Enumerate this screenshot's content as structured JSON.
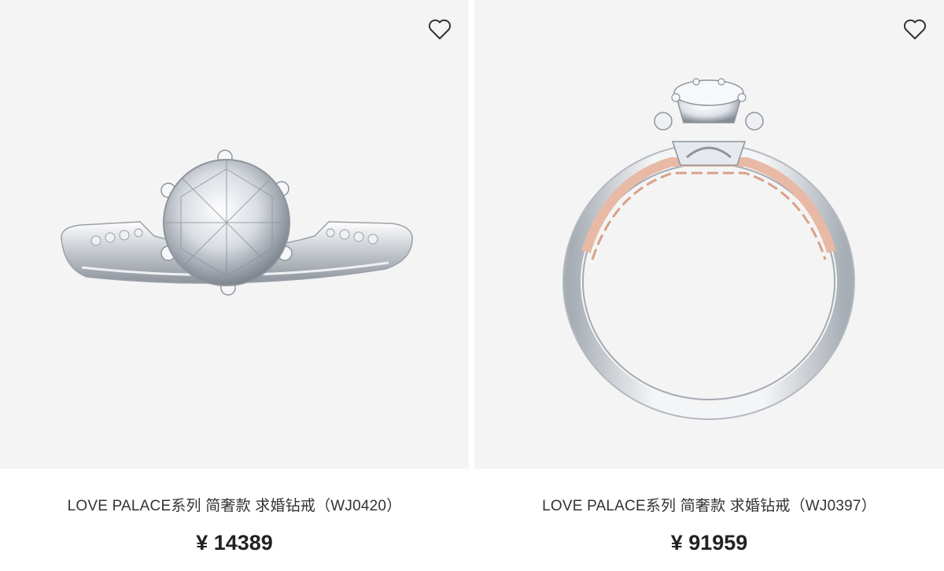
{
  "products": [
    {
      "title": "LOVE PALACE系列 简奢款 求婚钻戒（WJ0420）",
      "price": "¥ 14389",
      "image_alt": "solitaire diamond ring side view",
      "favorite_icon": "heart-outline-icon"
    },
    {
      "title": "LOVE PALACE系列 简奢款 求婚钻戒（WJ0397）",
      "price": "¥ 91959",
      "image_alt": "two-tone diamond ring front view",
      "favorite_icon": "heart-outline-icon"
    }
  ],
  "colors": {
    "image_bg": "#f4f4f4",
    "text": "#333333",
    "price": "#222222",
    "rose_gold": "#e8b9a4",
    "platinum": "#c9ccd1"
  }
}
